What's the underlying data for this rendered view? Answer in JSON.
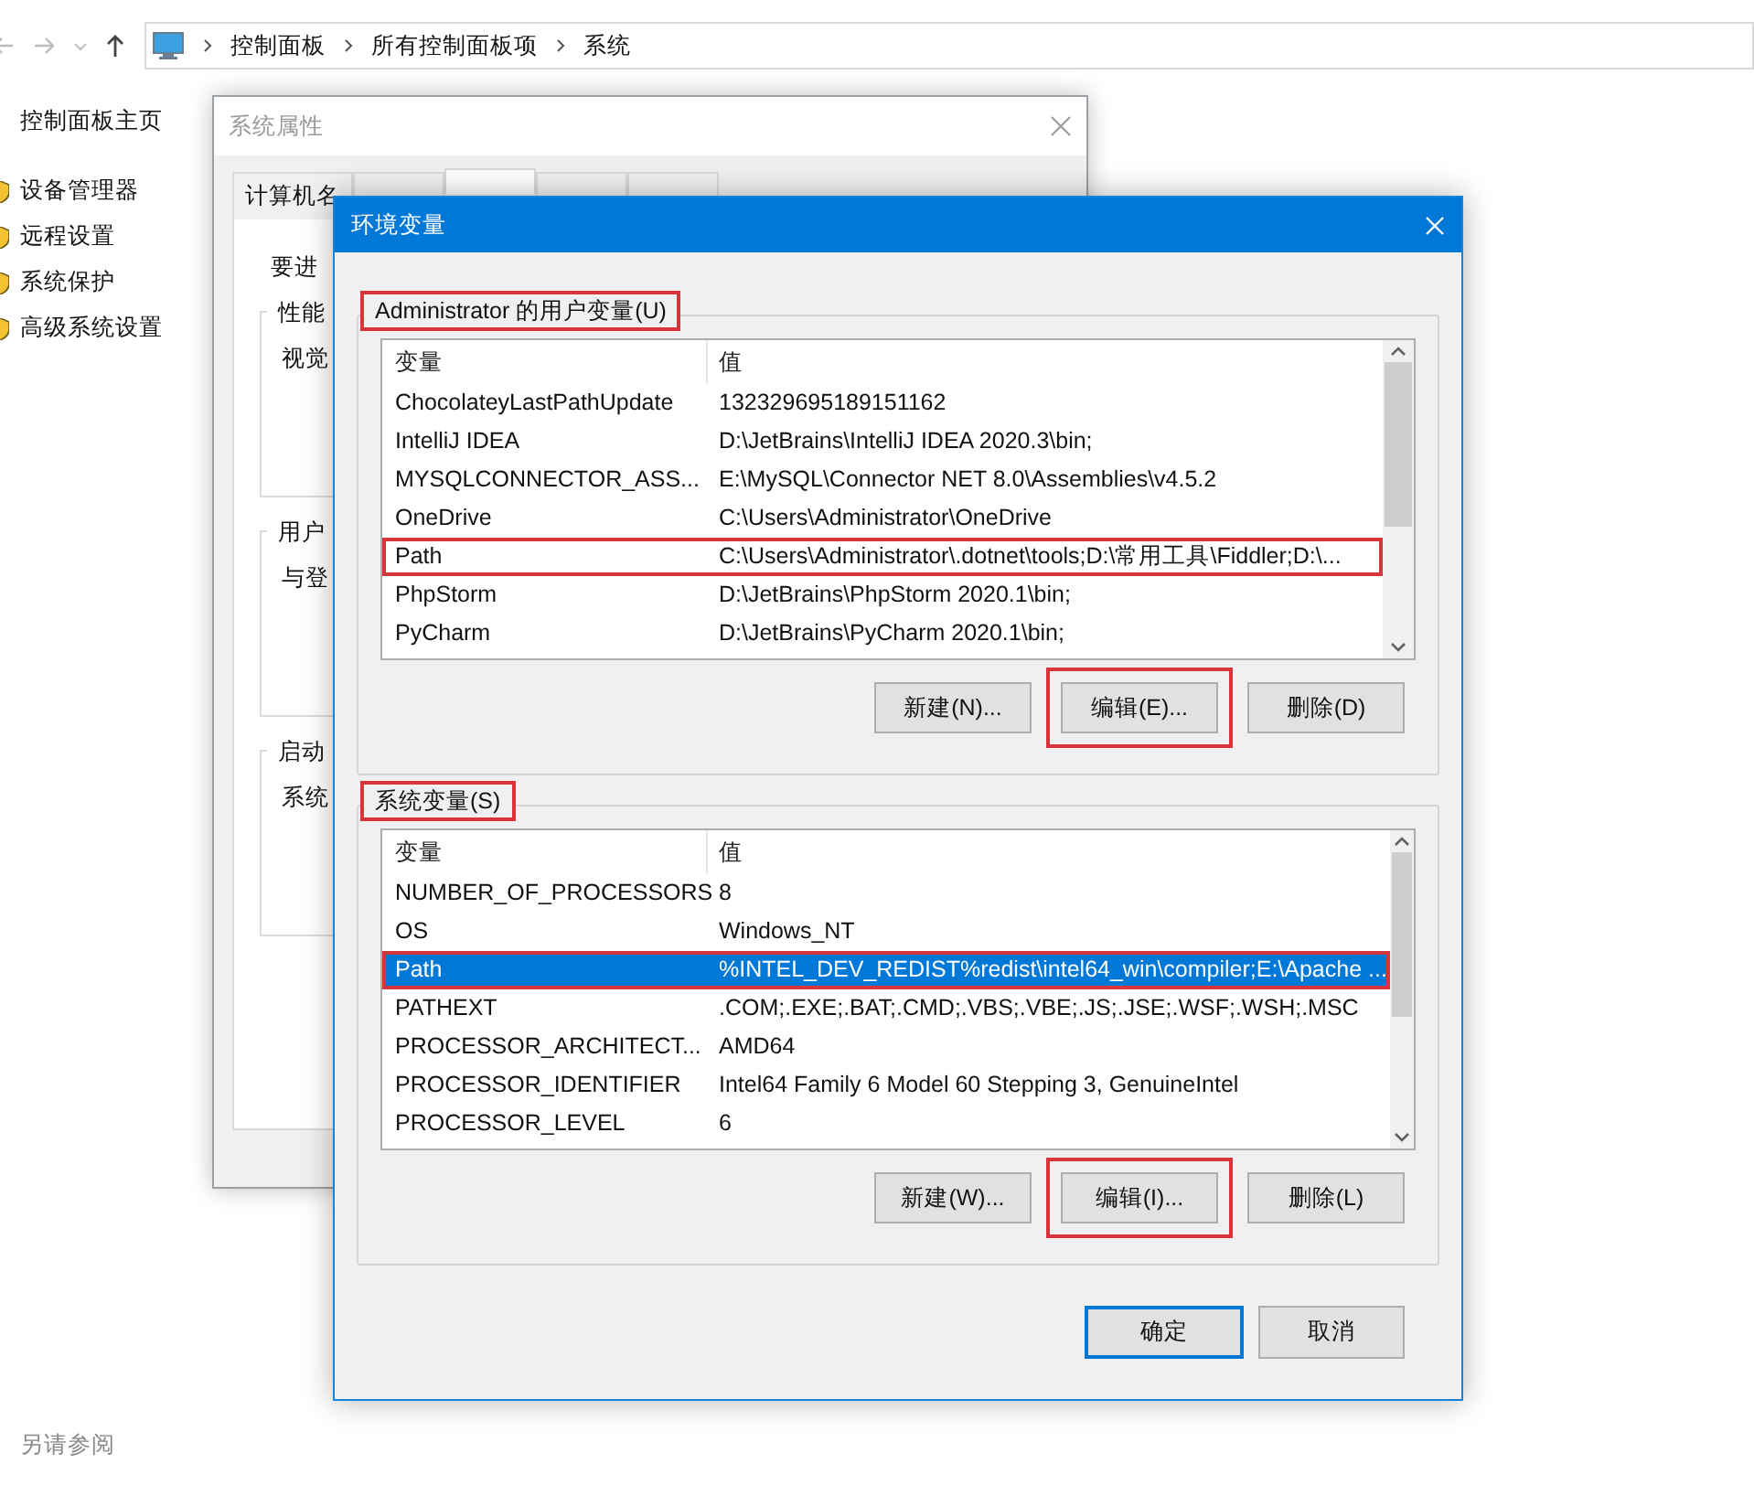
{
  "explorer": {
    "breadcrumbs": [
      "控制面板",
      "所有控制面板项",
      "系统"
    ],
    "sidebar": {
      "home": "控制面板主页",
      "items": [
        "设备管理器",
        "远程设置",
        "系统保护",
        "高级系统设置"
      ],
      "see_also": "另请参阅"
    }
  },
  "system_properties": {
    "title": "系统属性",
    "tabs": [
      {
        "label": "计算机名",
        "selected": false
      },
      {
        "selected": false
      },
      {
        "selected": true
      },
      {
        "selected": false
      },
      {
        "selected": false
      }
    ],
    "intro": "要进",
    "groups": [
      {
        "title": "性能",
        "text": "视觉"
      },
      {
        "title": "用户",
        "text": "与登"
      },
      {
        "title": "启动",
        "text": "系统"
      }
    ]
  },
  "env_dialog": {
    "title": "环境变量",
    "sections": [
      {
        "label": "Administrator 的用户变量(U)",
        "label_highlighted": true,
        "columns": [
          "变量",
          "值"
        ],
        "rows": [
          {
            "name": "ChocolateyLastPathUpdate",
            "value": "132329695189151162",
            "selected": false,
            "highlighted": false
          },
          {
            "name": "IntelliJ IDEA",
            "value": "D:\\JetBrains\\IntelliJ IDEA 2020.3\\bin;",
            "selected": false,
            "highlighted": false
          },
          {
            "name": "MYSQLCONNECTOR_ASS...",
            "value": "E:\\MySQL\\Connector NET 8.0\\Assemblies\\v4.5.2",
            "selected": false,
            "highlighted": false
          },
          {
            "name": "OneDrive",
            "value": "C:\\Users\\Administrator\\OneDrive",
            "selected": false,
            "highlighted": false
          },
          {
            "name": "Path",
            "value": "C:\\Users\\Administrator\\.dotnet\\tools;D:\\常用工具\\Fiddler;D:\\...",
            "selected": false,
            "highlighted": true
          },
          {
            "name": "PhpStorm",
            "value": "D:\\JetBrains\\PhpStorm 2020.1\\bin;",
            "selected": false,
            "highlighted": false
          },
          {
            "name": "PyCharm",
            "value": "D:\\JetBrains\\PyCharm 2020.1\\bin;",
            "selected": false,
            "highlighted": false
          }
        ],
        "buttons": [
          {
            "label": "新建(N)...",
            "highlighted": false
          },
          {
            "label": "编辑(E)...",
            "highlighted": true
          },
          {
            "label": "删除(D)",
            "highlighted": false
          }
        ]
      },
      {
        "label": "系统变量(S)",
        "label_highlighted": true,
        "columns": [
          "变量",
          "值"
        ],
        "rows": [
          {
            "name": "NUMBER_OF_PROCESSORS",
            "value": "8",
            "selected": false,
            "highlighted": false
          },
          {
            "name": "OS",
            "value": "Windows_NT",
            "selected": false,
            "highlighted": false
          },
          {
            "name": "Path",
            "value": "%INTEL_DEV_REDIST%redist\\intel64_win\\compiler;E:\\Apache ...",
            "selected": true,
            "highlighted": true
          },
          {
            "name": "PATHEXT",
            "value": ".COM;.EXE;.BAT;.CMD;.VBS;.VBE;.JS;.JSE;.WSF;.WSH;.MSC",
            "selected": false,
            "highlighted": false
          },
          {
            "name": "PROCESSOR_ARCHITECT...",
            "value": "AMD64",
            "selected": false,
            "highlighted": false
          },
          {
            "name": "PROCESSOR_IDENTIFIER",
            "value": "Intel64 Family 6 Model 60 Stepping 3, GenuineIntel",
            "selected": false,
            "highlighted": false
          },
          {
            "name": "PROCESSOR_LEVEL",
            "value": "6",
            "selected": false,
            "highlighted": false
          }
        ],
        "buttons": [
          {
            "label": "新建(W)...",
            "highlighted": false
          },
          {
            "label": "编辑(I)...",
            "highlighted": true
          },
          {
            "label": "删除(L)",
            "highlighted": false
          }
        ]
      }
    ],
    "ok": "确定",
    "cancel": "取消"
  }
}
